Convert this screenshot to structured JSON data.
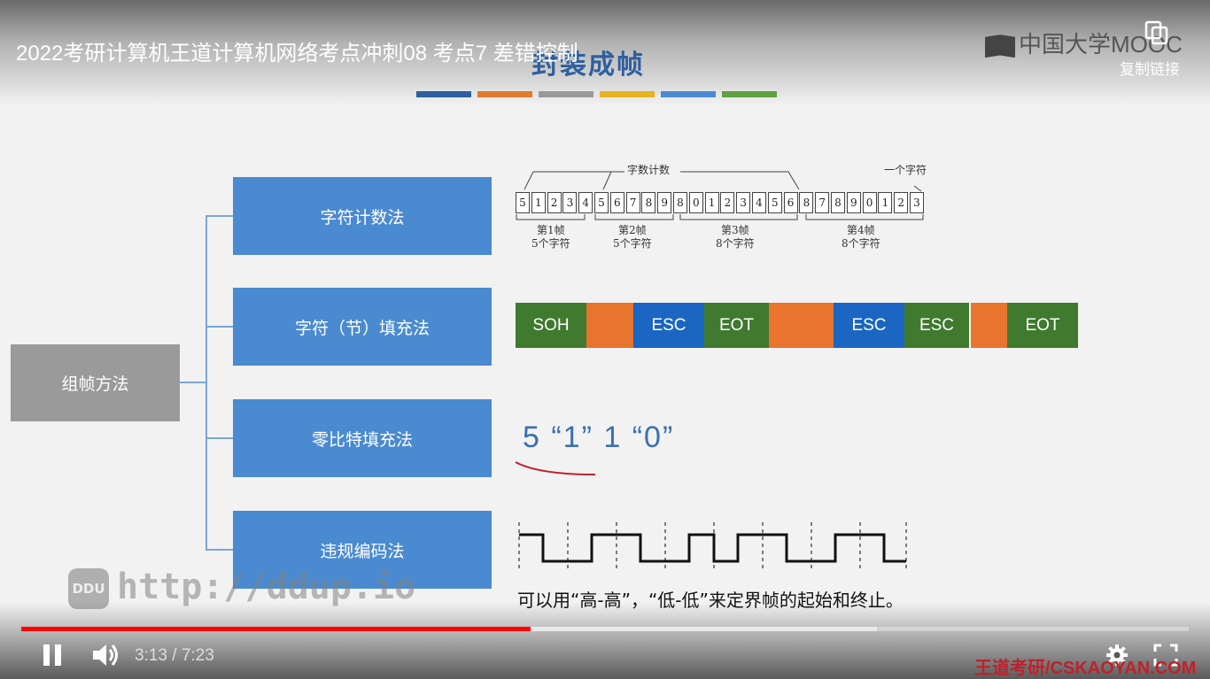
{
  "video": {
    "title": "2022考研计算机王道计算机网络考点冲刺08 考点7 差错控制",
    "brand": "中国大学MOOC",
    "copy_link_label": "复制链接",
    "current_time": "3:13",
    "separator": "/",
    "duration": "7:23",
    "progress_fraction": 0.436,
    "buffer_fraction": 0.733,
    "watermark": "王道考研/CSKAOYAN.COM",
    "overlay_logo": "DDU",
    "overlay_url": "http://ddup.io"
  },
  "slide": {
    "title": "封装成帧",
    "stripe_colors": [
      "#2f5f9e",
      "#e07a2e",
      "#999999",
      "#e8b31e",
      "#4a8ad0",
      "#5fa040"
    ],
    "root_label": "组帧方法",
    "methods": [
      {
        "label": "字符计数法"
      },
      {
        "label": "字符（节）填充法"
      },
      {
        "label": "零比特填充法"
      },
      {
        "label": "违规编码法"
      }
    ],
    "char_count": {
      "top_label": "字数计数",
      "right_label": "一个字符",
      "cells": [
        "5",
        "1",
        "2",
        "3",
        "4",
        "5",
        "6",
        "7",
        "8",
        "9",
        "8",
        "0",
        "1",
        "2",
        "3",
        "4",
        "5",
        "6",
        "8",
        "7",
        "8",
        "9",
        "0",
        "1",
        "2",
        "3"
      ],
      "frames": [
        {
          "name": "第1帧",
          "desc": "5个字符"
        },
        {
          "name": "第2帧",
          "desc": "5个字符"
        },
        {
          "name": "第3帧",
          "desc": "8个字符"
        },
        {
          "name": "第4帧",
          "desc": "8个字符"
        }
      ]
    },
    "byte_stuffing": {
      "blocks": [
        {
          "label": "SOH",
          "color": "#3f7a2e"
        },
        {
          "label": "",
          "color": "#e8742e"
        },
        {
          "label": "ESC",
          "color": "#1a66c2"
        },
        {
          "label": "EOT",
          "color": "#3f7a2e"
        },
        {
          "label": "",
          "color": "#e8742e"
        },
        {
          "label": "ESC",
          "color": "#1a66c2"
        },
        {
          "label": "ESC",
          "color": "#3f7a2e"
        },
        {
          "label": "",
          "color": "#e8742e"
        },
        {
          "label": "EOT",
          "color": "#3f7a2e"
        }
      ]
    },
    "zero_bit_text": "5 “1” 1 “0”",
    "violation_caption": "可以用“高-高”，“低-低”来定界帧的起始和终止。"
  }
}
